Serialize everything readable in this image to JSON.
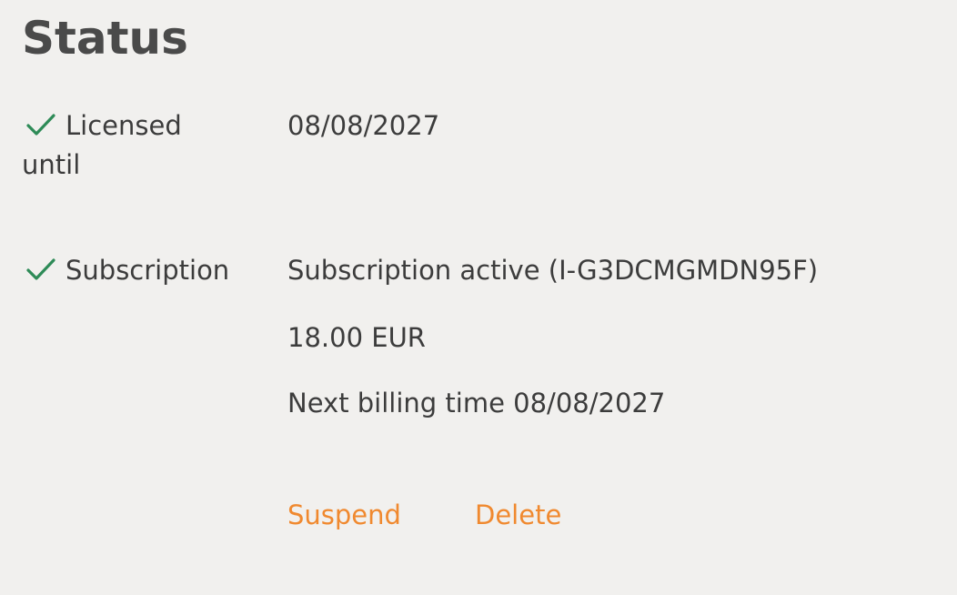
{
  "page": {
    "title": "Status"
  },
  "status_rows": {
    "licensed": {
      "label_line1": "Licensed",
      "label_line2": "until",
      "icon": "check-icon",
      "value": "08/08/2027"
    },
    "subscription": {
      "label": "Subscription",
      "icon": "check-icon",
      "status": "Subscription active (I-G3DCMGMDN95F)",
      "price": "18.00 EUR",
      "next_billing": "Next billing time 08/08/2027"
    }
  },
  "actions": {
    "suspend_label": "Suspend",
    "delete_label": "Delete"
  },
  "colors": {
    "background": "#f1f0ee",
    "text": "#3c3c3c",
    "title": "#4a4a4a",
    "check": "#2e8b57",
    "action": "#f0892f"
  }
}
